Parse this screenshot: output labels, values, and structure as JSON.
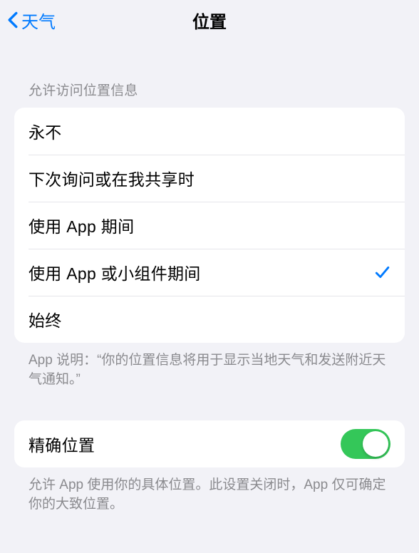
{
  "nav": {
    "back_label": "天气",
    "title": "位置"
  },
  "section1": {
    "header": "允许访问位置信息",
    "options": [
      {
        "label": "永不",
        "selected": false
      },
      {
        "label": "下次询问或在我共享时",
        "selected": false
      },
      {
        "label": "使用 App 期间",
        "selected": false
      },
      {
        "label": "使用 App 或小组件期间",
        "selected": true
      },
      {
        "label": "始终",
        "selected": false
      }
    ],
    "footer": "App 说明：“你的位置信息将用于显示当地天气和发送附近天气通知。”"
  },
  "section2": {
    "precise_label": "精确位置",
    "precise_on": true,
    "footer": "允许 App 使用你的具体位置。此设置关闭时，App 仅可确定你的大致位置。"
  }
}
